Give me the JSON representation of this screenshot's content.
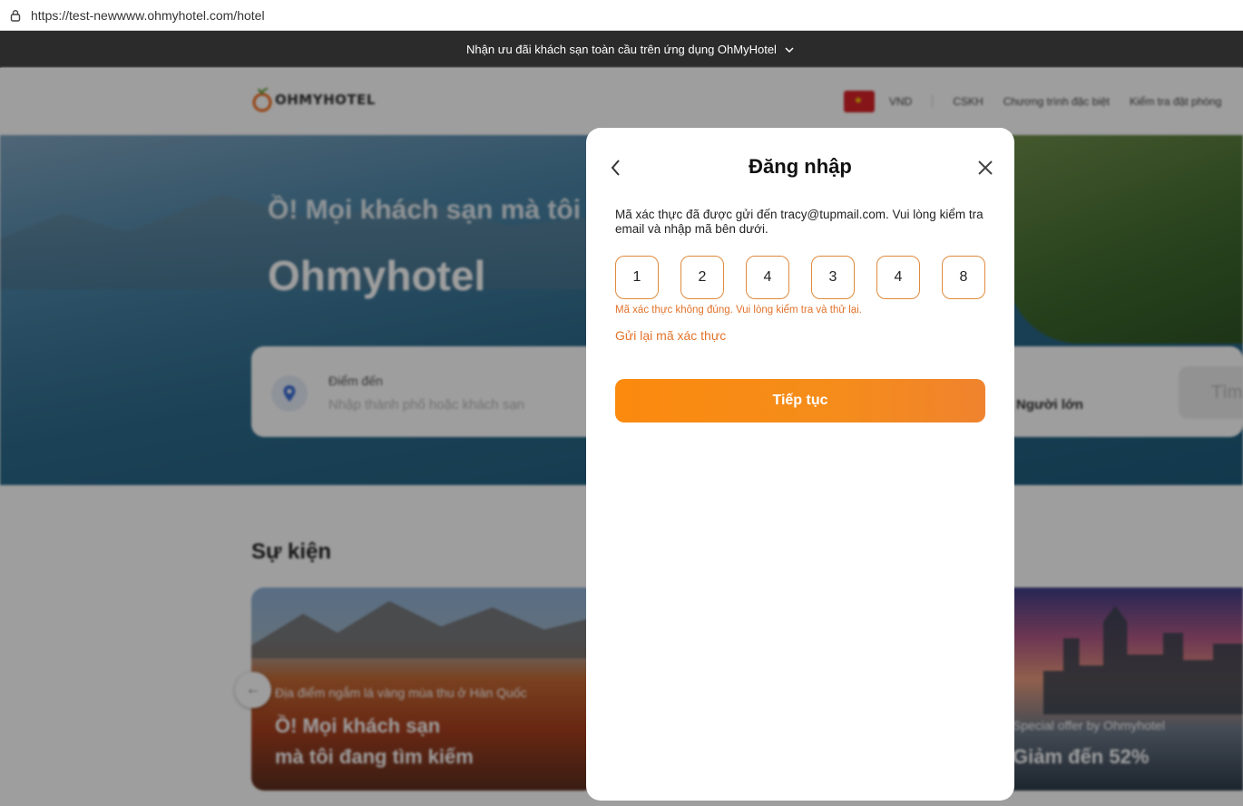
{
  "browser": {
    "url": "https://test-newwww.ohmyhotel.com/hotel"
  },
  "promo": {
    "text": "Nhận ưu đãi khách sạn toàn cầu trên ứng dụng OhMyHotel"
  },
  "header": {
    "logo": "OHMYHOTEL",
    "currency": "VND",
    "support": "CSKH",
    "special": "Chương trình đặc biệt",
    "check_booking": "Kiểm tra đặt phòng"
  },
  "hero": {
    "tagline": "Ồ! Mọi khách sạn mà tôi",
    "brand": "Ohmyhotel"
  },
  "search": {
    "destination_label": "Điểm đến",
    "destination_placeholder": "Nhập thành phố hoặc khách sạn",
    "guests": "Người lớn",
    "button": "Tìm"
  },
  "events": {
    "title": "Sự kiện",
    "cards": [
      {
        "subtitle": "Địa điểm ngắm lá vàng mùa thu ở Hàn Quốc",
        "line1": "Ồ! Mọi khách sạn",
        "line2": "mà tôi đang tìm kiếm"
      },
      {
        "subtitle": "Special offer by Ohmyhotel",
        "line1": "Giảm đến 52%"
      }
    ]
  },
  "modal": {
    "title": "Đăng nhập",
    "description": "Mã xác thực đã được gửi đến tracy@tupmail.com. Vui lòng kiểm tra email và nhập mã bên dưới.",
    "otp": [
      "1",
      "2",
      "4",
      "3",
      "4",
      "8"
    ],
    "error": "Mã xác thực không đúng. Vui lòng kiểm tra và thử lại.",
    "resend": "Gửi lại mã xác thực",
    "continue": "Tiếp tục"
  },
  "colors": {
    "accent": "#f58a1a",
    "error": "#e2722a",
    "banner": "#2b2b2b"
  }
}
